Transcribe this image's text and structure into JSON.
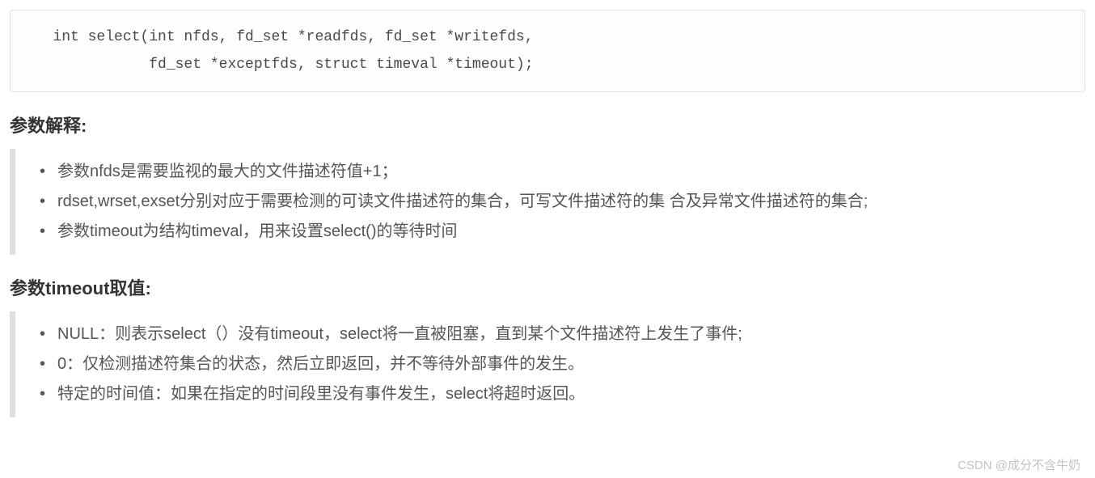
{
  "code": {
    "content": "   int select(int nfds, fd_set *readfds, fd_set *writefds,\n              fd_set *exceptfds, struct timeval *timeout);"
  },
  "section1": {
    "heading": "参数解释:",
    "items": [
      "参数nfds是需要监视的最大的文件描述符值+1；",
      "rdset,wrset,exset分别对应于需要检测的可读文件描述符的集合，可写文件描述符的集 合及异常文件描述符的集合;",
      "参数timeout为结构timeval，用来设置select()的等待时间"
    ]
  },
  "section2": {
    "heading": "参数timeout取值:",
    "items": [
      "NULL：则表示select（）没有timeout，select将一直被阻塞，直到某个文件描述符上发生了事件;",
      "0：仅检测描述符集合的状态，然后立即返回，并不等待外部事件的发生。",
      "特定的时间值：如果在指定的时间段里没有事件发生，select将超时返回。"
    ]
  },
  "watermark": "CSDN @成分不含牛奶"
}
